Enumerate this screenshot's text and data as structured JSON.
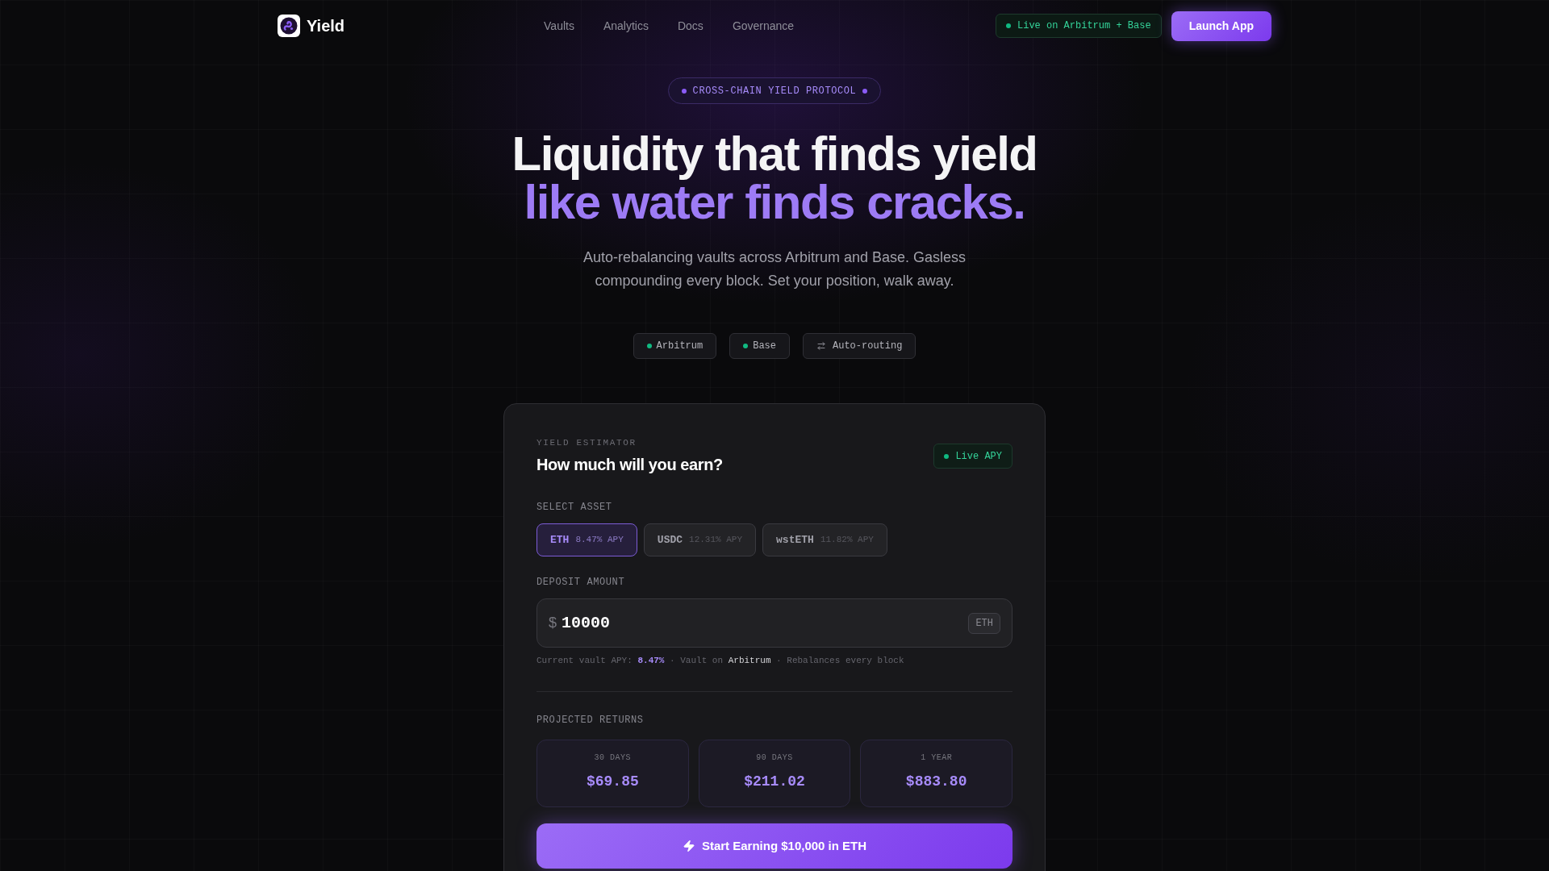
{
  "header": {
    "logo": "Yield",
    "nav": [
      "Vaults",
      "Analytics",
      "Docs",
      "Governance"
    ],
    "status": "Live on Arbitrum + Base",
    "cta": "Launch App"
  },
  "hero": {
    "badge": "CROSS-CHAIN YIELD PROTOCOL",
    "title": "Liquidity that finds yield",
    "title_accent": "like water finds cracks.",
    "subtitle": "Auto-rebalancing vaults across Arbitrum and Base. Gasless compounding every block. Set your position, walk away.",
    "chips": [
      {
        "label": "Arbitrum",
        "kind": "network"
      },
      {
        "label": "Base",
        "kind": "network"
      },
      {
        "label": "Auto-routing",
        "kind": "routing"
      }
    ]
  },
  "estimator": {
    "eyebrow": "YIELD ESTIMATOR",
    "title": "How much will you earn?",
    "live_badge": "Live APY",
    "asset_label": "SELECT ASSET",
    "assets": [
      {
        "symbol": "ETH",
        "apy": "8.47% APY",
        "selected": true
      },
      {
        "symbol": "USDC",
        "apy": "12.31% APY",
        "selected": false
      },
      {
        "symbol": "wstETH",
        "apy": "11.82% APY",
        "selected": false
      }
    ],
    "deposit_label": "DEPOSIT AMOUNT",
    "deposit": {
      "prefix": "$",
      "value": "10000",
      "unit": "ETH"
    },
    "info": [
      {
        "kind": "plain",
        "text": "Current vault APY:"
      },
      {
        "kind": "rate",
        "text": "8.47%"
      },
      {
        "kind": "plain",
        "text": "· Vault on"
      },
      {
        "kind": "place",
        "text": "Arbitrum"
      },
      {
        "kind": "plain",
        "text": "· Rebalances every block"
      }
    ],
    "returns_label": "PROJECTED RETURNS",
    "returns": [
      {
        "period": "30 DAYS",
        "amount": "$69.85"
      },
      {
        "period": "90 DAYS",
        "amount": "$211.02"
      },
      {
        "period": "1 YEAR",
        "amount": "$883.80"
      }
    ],
    "cta": "Start Earning $10,000 in ETH"
  }
}
